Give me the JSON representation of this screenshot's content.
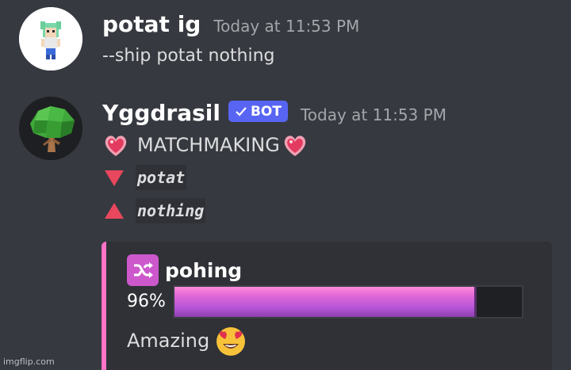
{
  "messages": [
    {
      "author": "potat ig",
      "timestamp": "Today at 11:53 PM",
      "content": "--ship potat nothing"
    },
    {
      "author": "Yggdrasil",
      "bot_tag": "BOT",
      "timestamp": "Today at 11:53 PM",
      "matchmaking_label": "MATCHMAKING",
      "name_down": "potat",
      "name_up": "nothing"
    }
  ],
  "embed": {
    "title": "pohing",
    "percent_text": "96%",
    "percent_value": 0.87,
    "verdict": "Amazing",
    "accent_color": "#ff73c8",
    "bar_color": "#e068d8"
  },
  "icons": {
    "avatar1": "pixel-character-avatar",
    "avatar2": "tree-avatar",
    "heart": "sparkling-heart-icon",
    "down": "red-triangle-down-icon",
    "up": "red-triangle-up-icon",
    "shuffle": "shuffle-icon",
    "emoji": "heart-eyes-emoji-icon"
  },
  "watermark": "imgflip.com"
}
